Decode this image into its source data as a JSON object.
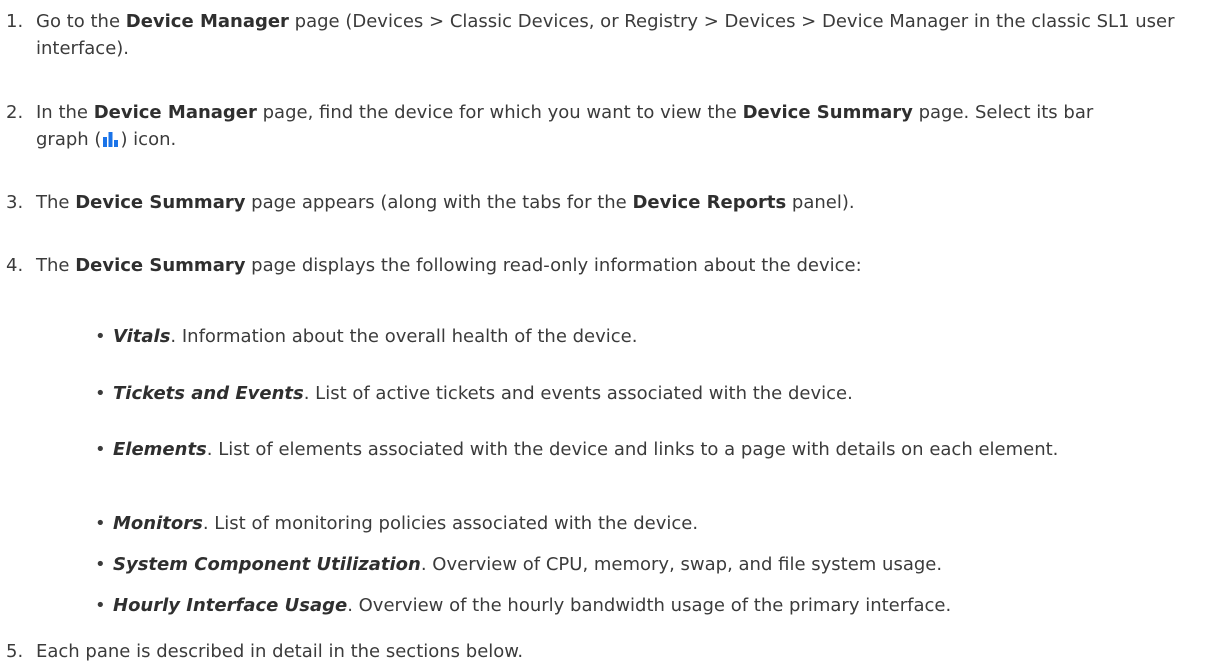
{
  "steps": [
    {
      "num": "1.",
      "parts": [
        {
          "t": "Go to the ",
          "s": "n"
        },
        {
          "t": "Device Manager",
          "s": "b"
        },
        {
          "t": " page (Devices > Classic Devices, or Registry > Devices > Device Manager in the classic SL1 user interface).",
          "s": "n"
        }
      ]
    },
    {
      "num": "2.",
      "parts": [
        {
          "t": "In the ",
          "s": "n"
        },
        {
          "t": "Device Manager",
          "s": "b"
        },
        {
          "t": " page, find the device for which you want to view the ",
          "s": "n"
        },
        {
          "t": "Device Summary",
          "s": "b"
        },
        {
          "t": " page. Select its bar graph (",
          "s": "n"
        },
        {
          "icon": "bar-graph-icon"
        },
        {
          "t": ") icon.",
          "s": "n"
        }
      ]
    },
    {
      "num": "3.",
      "parts": [
        {
          "t": "The ",
          "s": "n"
        },
        {
          "t": "Device Summary",
          "s": "b"
        },
        {
          "t": " page appears (along with the tabs for the ",
          "s": "n"
        },
        {
          "t": "Device Reports",
          "s": "b"
        },
        {
          "t": " panel).",
          "s": "n"
        }
      ]
    },
    {
      "num": "4.",
      "parts": [
        {
          "t": "The ",
          "s": "n"
        },
        {
          "t": "Device Summary",
          "s": "b"
        },
        {
          "t": " page displays the following read-only information about the device:",
          "s": "n"
        }
      ]
    },
    {
      "num": "5.",
      "parts": [
        {
          "t": "Each pane is described in detail in the sections below.",
          "s": "n"
        }
      ]
    }
  ],
  "bullets": [
    {
      "term": "Vitals",
      "desc": ". Information about the overall health of the device."
    },
    {
      "term": "Tickets and Events",
      "desc": ". List of active tickets and events associated with the device."
    },
    {
      "term": "Elements",
      "desc": ". List of elements associated with the device and links to a page with details on each element."
    },
    {
      "term": "Monitors",
      "desc": ". List of monitoring policies associated with the device."
    },
    {
      "term": "System Component Utilization",
      "desc": ". Overview of CPU, memory, swap, and file system usage."
    },
    {
      "term": "Hourly Interface Usage",
      "desc": ". Overview of the hourly bandwidth usage of the primary interface."
    }
  ],
  "bullet_glyph": "•",
  "icons": {
    "bar-graph-icon": {
      "color": "#1a73e8"
    }
  }
}
